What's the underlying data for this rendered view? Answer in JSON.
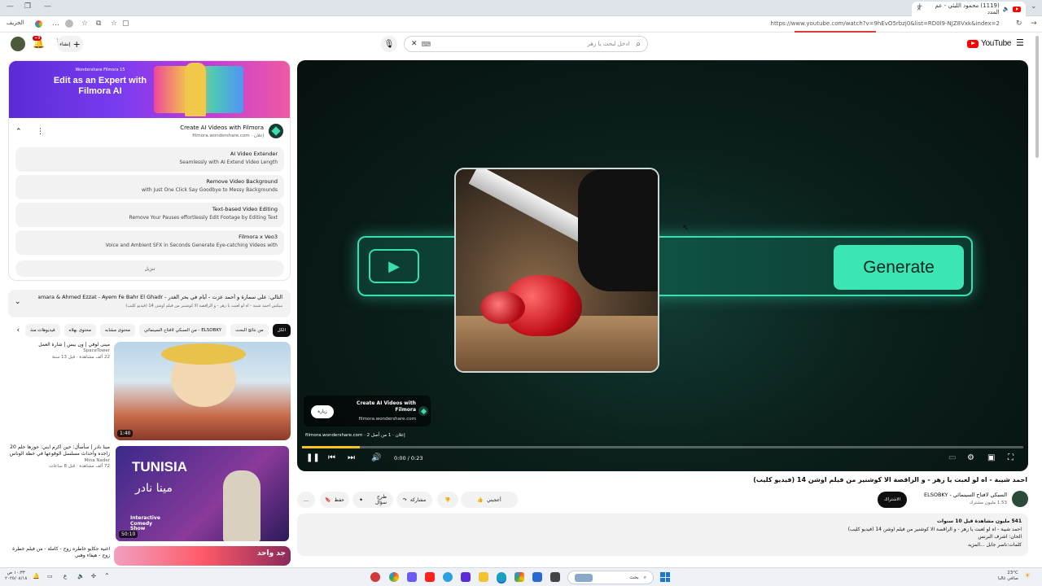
{
  "browser": {
    "tab_title": "(1119) محمود الليثي - عم المدد",
    "url": "https://www.youtube.com/watch?v=9hEvO5rbzj0&list=RD0l9-NJZ8Vxk&index=2",
    "profile_label": "الخريف"
  },
  "header": {
    "logo_text": "YouTube",
    "search_placeholder": "ادخل لبحث يا زهر",
    "create_label": "إنشاء",
    "notif_count": "+9"
  },
  "ad": {
    "banner_brand": "Wondershare Filmora 15",
    "banner_text": "Edit as an Expert with Filmora AI",
    "title": "Create AI Videos with Filmora",
    "domain": "إعلان · filmora.wondershare.com",
    "rows": [
      {
        "title": "AI Video Extender",
        "sub": "Seamlessly with AI Extend Video Length"
      },
      {
        "title": "Remove Video Background",
        "sub": "with Just One Click Say Goodbye to Messy Backgrounds"
      },
      {
        "title": "Text-based Video Editing",
        "sub": "Remove Your Pauses effortlessly Edit Footage by Editing Text"
      },
      {
        "title": "Filmora x Veo3",
        "sub": "Voice and Ambient SFX in Seconds Generate Eye-catching Videos with"
      }
    ],
    "download_label": "تنزيل"
  },
  "next_up": {
    "title": "التالي: علي سمارة و أحمد عزت - أيام في بحر الغدر - Ali Samara & Ahmed Ezzat - Ayem Fe Bahr El Ghadr",
    "sub": "ميكس احمد شيبة - اه لو لعبت يا زهر - و الراقصة الا كوشنير من فيلم اوشن 14 (فيديو كليب)"
  },
  "chips": [
    "الكل",
    "من نتائج البحث",
    "من السبكي لافتاح السينمائي - ELSOBKY",
    "محتوى مشابه",
    "محتوى بهلاه",
    "فيديوهات منذ"
  ],
  "videos": [
    {
      "title": "مينى لوفي | ون بيس | شارة العمل",
      "channel": "SpaceTower",
      "meta": "22 ألف مشاهدة · قبل 13 سنة",
      "duration": "1:40"
    },
    {
      "title": "مينا نادر | سأسأل: حين اكرم ابني: جوزها حلم 20 زاجده وأحداث مسلسل الوقوعها في خطة الوناس",
      "channel": "Mina Nader",
      "meta": "72 ألف مشاهدة · قبل 8 ساعات",
      "duration": "50:10",
      "thumb_title": "TUNISIA",
      "thumb_sub": "مينا نادر",
      "thumb_badge": "Interactive Comedy Show"
    },
    {
      "title": "اغنية حكايو خاطره زوح - كاملة - من فيلم خطرة زوج - هيفاء وهبي",
      "channel": "",
      "meta": "",
      "duration": "",
      "thumb_title": "جد واحد"
    }
  ],
  "player": {
    "ad_card_title": "Create AI Videos with Filmora",
    "ad_card_domain": "filmora.wondershare.com",
    "ad_skip": "زيارة",
    "ad_info": "إعلان · 1 من أصل 2 · filmora.wondershare.com",
    "time": "0:00 / 0:23",
    "generate_label": "Generate",
    "progress": 0.08
  },
  "video": {
    "title": "احمد شيبة - اه لو لعبت يا زهر - و الراقصة الا كوشنير من فيلم اوشن 14 (فيديو كليب)",
    "channel": "السبكي لافتاح السينمائي - ELSOBKY",
    "subs": "1.53 مليون مشترك",
    "subscribe": "الاشتراك",
    "like": "أعجبني",
    "share": "مشاركة",
    "ask": "طرح سؤال",
    "save": "حفظ",
    "desc_line1": "541 مليون مشاهدة  قبل 10 سنوات",
    "desc_line2": "احمد شيبة - اه لو لعبت يا زهر - و الراقصة الا كوشنير من فيلم اوشن 14 (فيديو كليب)",
    "desc_line3": "الحان: اشرف البرنس",
    "desc_line4": "كلمات:ناصر جابل ...المزيد"
  },
  "taskbar": {
    "weather": "23°C",
    "weather_desc": "صافي غالبا",
    "search": "بحث",
    "clock_time": "١٠:٣٣ ص",
    "clock_date": "٢٠٢٥/٠٨/١٨"
  }
}
